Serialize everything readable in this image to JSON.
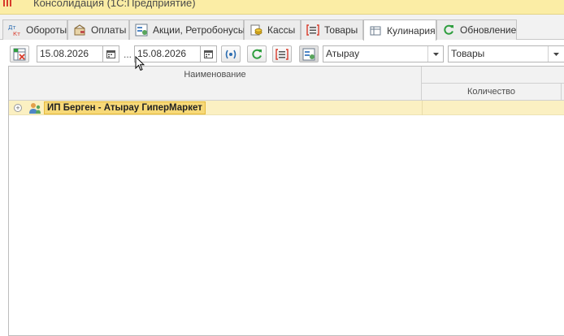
{
  "window": {
    "title": "Консолидация  (1С:Предприятие)"
  },
  "tabs": [
    {
      "label": "Обороты",
      "icon": "debit-credit-icon",
      "active": false
    },
    {
      "label": "Оплаты",
      "icon": "wallet-icon",
      "active": false
    },
    {
      "label": "Акции, Ретробонусы",
      "icon": "report-settings-icon",
      "active": false
    },
    {
      "label": "Кассы",
      "icon": "coins-icon",
      "active": false
    },
    {
      "label": "Товары",
      "icon": "list-icon",
      "active": false
    },
    {
      "label": "Кулинария",
      "icon": "table-icon",
      "active": true
    },
    {
      "label": "Обновление",
      "icon": "refresh-icon",
      "active": false
    }
  ],
  "toolbar": {
    "date_from": "15.08.2026",
    "date_separator": "...",
    "date_to": "15.08.2026",
    "region_select": "Атырау",
    "group_select": "Товары"
  },
  "grid": {
    "columns": {
      "name": "Наименование",
      "quantity": "Количество"
    },
    "rows": [
      {
        "name": "ИП Берген - Атырау ГиперМаркет",
        "quantity": ""
      }
    ]
  },
  "colors": {
    "title_bar": "#fbeda5",
    "selected_row": "#fbf0c2",
    "selected_cell": "#f7d978",
    "accent_green": "#2e9e3e",
    "accent_red": "#d83b2b"
  }
}
